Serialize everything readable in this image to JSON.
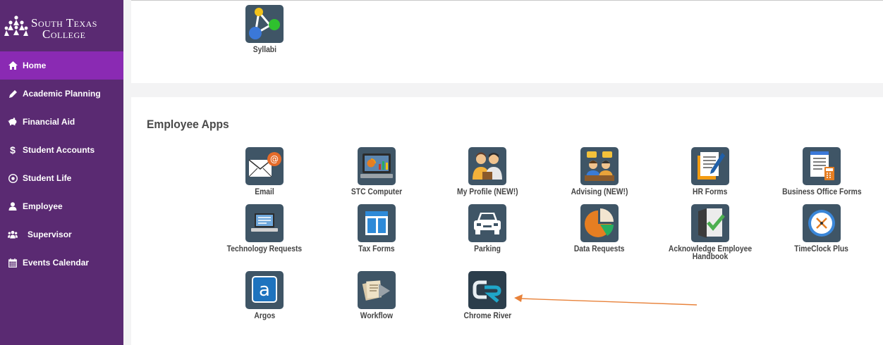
{
  "sidebar": {
    "logo": {
      "line1": "South Texas",
      "line2": "College"
    },
    "items": [
      {
        "label": "Home",
        "icon": "home-icon"
      },
      {
        "label": "Academic Planning",
        "icon": "pencil-icon"
      },
      {
        "label": "Financial Aid",
        "icon": "piggy-bank-icon"
      },
      {
        "label": "Student Accounts",
        "icon": "dollar-icon"
      },
      {
        "label": "Student Life",
        "icon": "soccer-ball-icon"
      },
      {
        "label": "Employee",
        "icon": "user-icon"
      },
      {
        "label": "Supervisor",
        "icon": "users-icon"
      },
      {
        "label": "Events Calendar",
        "icon": "calendar-icon"
      }
    ],
    "active_item": "Home"
  },
  "top_section": {
    "apps": [
      {
        "label": "Syllabi",
        "icon": "syllabi-network-icon"
      }
    ]
  },
  "employee_apps": {
    "title": "Employee Apps",
    "apps": [
      {
        "label": "Email",
        "icon": "email-icon"
      },
      {
        "label": "STC Computer",
        "icon": "computer-icon"
      },
      {
        "label": "My Profile (NEW!)",
        "icon": "profile-icon"
      },
      {
        "label": "Advising (NEW!)",
        "icon": "advising-icon"
      },
      {
        "label": "HR Forms",
        "icon": "hr-forms-icon"
      },
      {
        "label": "Business Office Forms",
        "icon": "business-forms-icon"
      },
      {
        "label": "Technology Requests",
        "icon": "laptop-icon"
      },
      {
        "label": "Tax Forms",
        "icon": "tax-forms-icon"
      },
      {
        "label": "Parking",
        "icon": "car-icon"
      },
      {
        "label": "Data Requests",
        "icon": "pie-chart-icon"
      },
      {
        "label": "Acknowledge Employee Handbook",
        "icon": "handbook-check-icon"
      },
      {
        "label": "TimeClock Plus",
        "icon": "clock-icon"
      },
      {
        "label": "Argos",
        "icon": "argos-icon"
      },
      {
        "label": "Workflow",
        "icon": "workflow-icon"
      },
      {
        "label": "Chrome River",
        "icon": "chrome-river-icon"
      }
    ]
  },
  "colors": {
    "sidebar_bg": "#5a2a72",
    "active_item_bg": "#8a2ab3",
    "icon_tile_bg": "#3f5566",
    "annotation_arrow": "#e8823a"
  }
}
